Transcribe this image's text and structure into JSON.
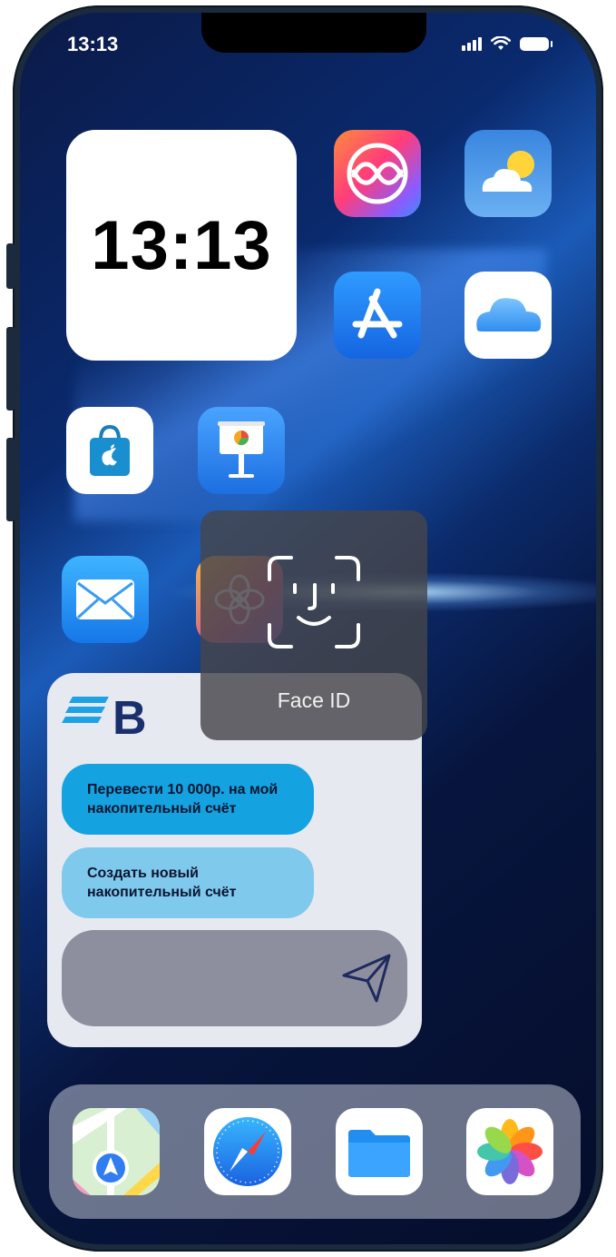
{
  "status_bar": {
    "time": "13:13"
  },
  "clock_widget": {
    "time": "13:13"
  },
  "home_apps": [
    "image-playground-app",
    "weather-app",
    "app-store-app",
    "icloud-app",
    "apple-store-app",
    "keynote-app",
    "mail-app",
    "apple-intelligence-app"
  ],
  "bank_widget": {
    "logo_letter": "B",
    "suggestion_1": "Перевести 10 000р. на мой накопительный счёт",
    "suggestion_2": "Создать новый накопительный счёт",
    "input_placeholder": "",
    "send_icon": "send-icon"
  },
  "faceid": {
    "label": "Face ID",
    "icon": "face-id-icon"
  },
  "dock_apps": [
    "maps-app",
    "safari-app",
    "files-app",
    "photos-app"
  ],
  "colors": {
    "bank_primary": "#14a3e0",
    "bank_secondary": "#7fc9ec",
    "bank_brand": "#1a2f6e"
  }
}
